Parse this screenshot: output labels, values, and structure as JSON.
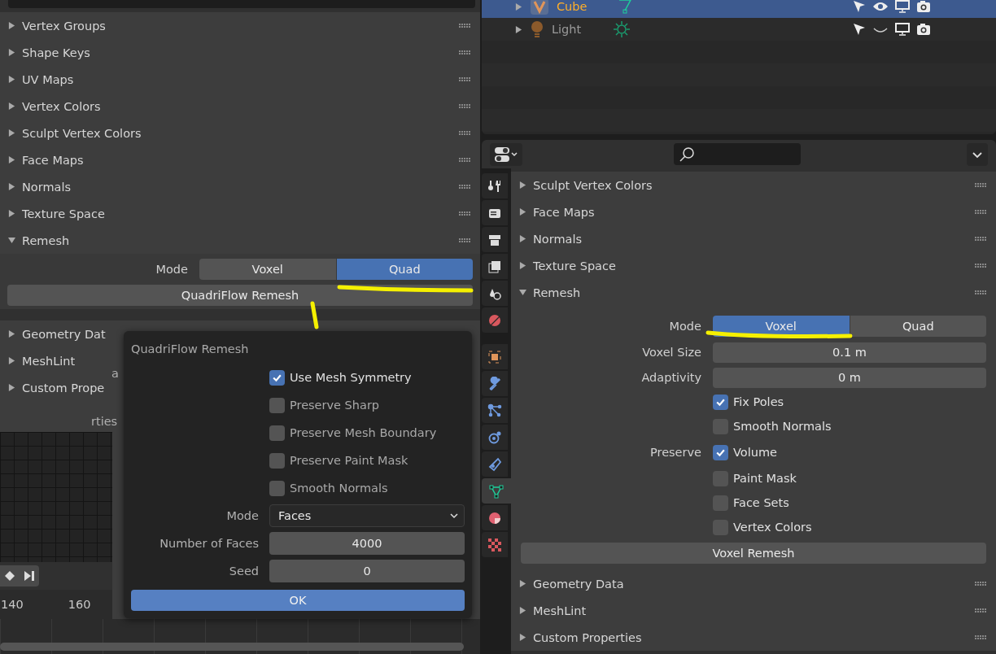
{
  "left_panel": {
    "sections_top": [
      {
        "label": "Vertex Groups",
        "expanded": false
      },
      {
        "label": "Shape Keys",
        "expanded": false
      },
      {
        "label": "UV Maps",
        "expanded": false
      },
      {
        "label": "Vertex Colors",
        "expanded": false
      },
      {
        "label": "Sculpt Vertex Colors",
        "expanded": false
      },
      {
        "label": "Face Maps",
        "expanded": false
      },
      {
        "label": "Normals",
        "expanded": false
      },
      {
        "label": "Texture Space",
        "expanded": false
      },
      {
        "label": "Remesh",
        "expanded": true
      }
    ],
    "remesh": {
      "mode_label": "Mode",
      "modes": [
        {
          "label": "Voxel",
          "selected": false
        },
        {
          "label": "Quad",
          "selected": true
        }
      ],
      "button": "QuadriFlow Remesh"
    },
    "sections_bottom": [
      {
        "label": "Geometry Dat",
        "expanded": false
      },
      {
        "label": "MeshLint",
        "expanded": false
      },
      {
        "label": "Custom Prope",
        "expanded": false
      }
    ],
    "fragments": [
      "a",
      "rties"
    ],
    "timeline": {
      "frames": [
        "140",
        "160"
      ]
    }
  },
  "popup": {
    "title": "QuadriFlow Remesh",
    "options": [
      {
        "label": "Use Mesh Symmetry",
        "checked": true
      },
      {
        "label": "Preserve Sharp",
        "checked": false
      },
      {
        "label": "Preserve Mesh Boundary",
        "checked": false
      },
      {
        "label": "Preserve Paint Mask",
        "checked": false
      },
      {
        "label": "Smooth Normals",
        "checked": false
      }
    ],
    "fields": [
      {
        "kind": "dropdown",
        "label": "Mode",
        "value": "Faces"
      },
      {
        "kind": "number",
        "label": "Number of Faces",
        "value": "4000"
      },
      {
        "kind": "number",
        "label": "Seed",
        "value": "0"
      }
    ],
    "ok": "OK"
  },
  "outliner": {
    "rows": [
      {
        "kind": "mesh",
        "name": "Cube",
        "selected": true,
        "visible": true
      },
      {
        "kind": "light",
        "name": "Light",
        "selected": false,
        "visible": false
      }
    ]
  },
  "properties": {
    "tabs": [
      {
        "kind": "tool",
        "selected": false
      },
      {
        "kind": "render",
        "selected": false
      },
      {
        "kind": "output",
        "selected": false
      },
      {
        "kind": "view_layer",
        "selected": false
      },
      {
        "kind": "scene",
        "selected": false
      },
      {
        "kind": "world",
        "selected": false
      },
      {
        "kind": "object",
        "selected": false
      },
      {
        "kind": "modifier",
        "selected": false
      },
      {
        "kind": "particles",
        "selected": false
      },
      {
        "kind": "physics",
        "selected": false
      },
      {
        "kind": "constraints",
        "selected": false
      },
      {
        "kind": "data",
        "selected": true
      },
      {
        "kind": "material",
        "selected": false
      },
      {
        "kind": "texture",
        "selected": false
      }
    ],
    "sections_top": [
      {
        "label": "Sculpt Vertex Colors",
        "expanded": false
      },
      {
        "label": "Face Maps",
        "expanded": false
      },
      {
        "label": "Normals",
        "expanded": false
      },
      {
        "label": "Texture Space",
        "expanded": false
      },
      {
        "label": "Remesh",
        "expanded": true
      }
    ],
    "remesh": {
      "mode_label": "Mode",
      "modes": [
        {
          "label": "Voxel",
          "selected": true
        },
        {
          "label": "Quad",
          "selected": false
        }
      ],
      "fields": [
        {
          "label": "Voxel Size",
          "value": "0.1 m"
        },
        {
          "label": "Adaptivity",
          "value": "0 m"
        }
      ],
      "options": [
        {
          "label": "Fix Poles",
          "checked": true
        },
        {
          "label": "Smooth Normals",
          "checked": false
        }
      ],
      "preserve_label": "Preserve",
      "preserve": [
        {
          "label": "Volume",
          "checked": true
        },
        {
          "label": "Paint Mask",
          "checked": false
        },
        {
          "label": "Face Sets",
          "checked": false
        },
        {
          "label": "Vertex Colors",
          "checked": false
        }
      ],
      "button": "Voxel Remesh"
    },
    "sections_bottom": [
      {
        "label": "Geometry Data",
        "expanded": false
      },
      {
        "label": "MeshLint",
        "expanded": false
      },
      {
        "label": "Custom Properties",
        "expanded": false
      }
    ]
  }
}
